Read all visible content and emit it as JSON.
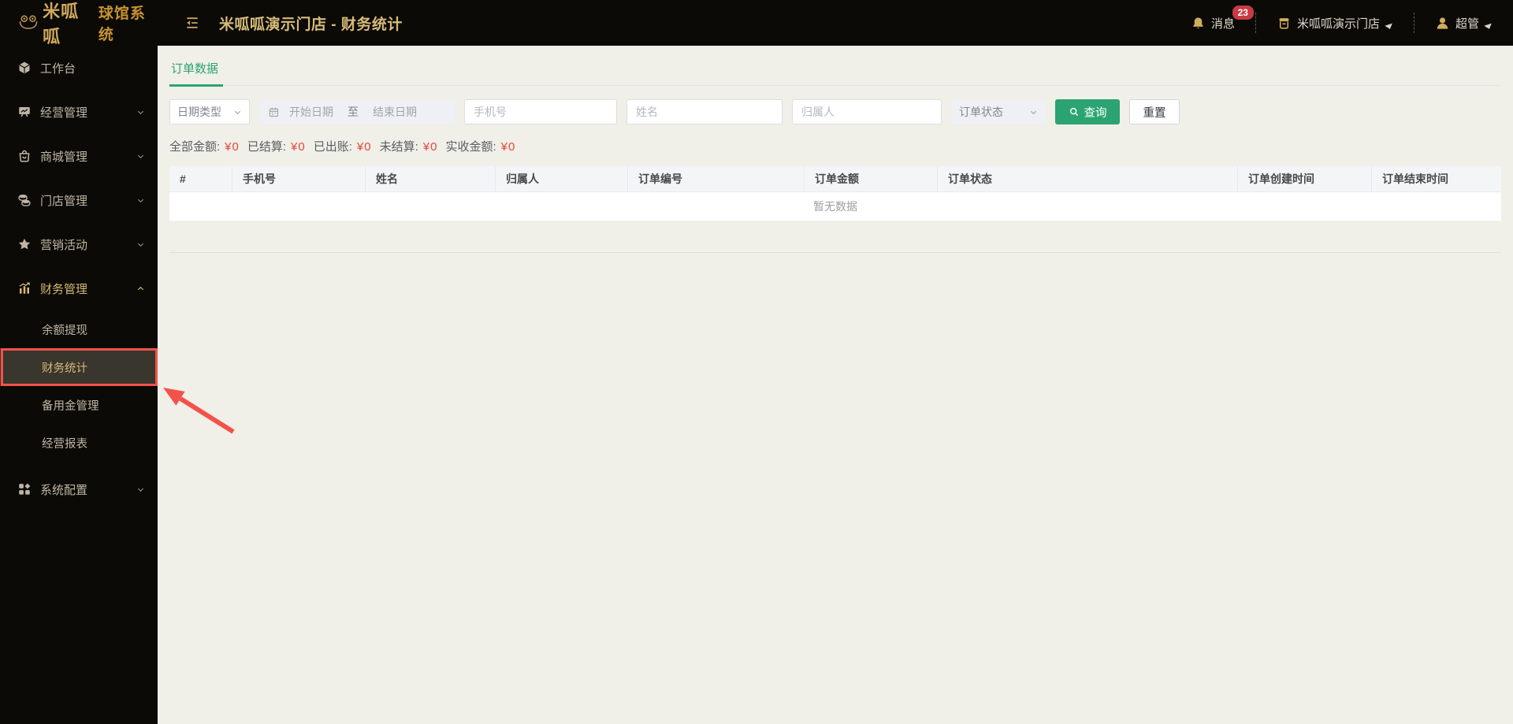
{
  "colors": {
    "accent_green": "#2ba471",
    "value_red": "#e5473c",
    "gold": "#d6b877",
    "annotation_red": "#f3524a",
    "topbar_bg": "#0b0a06",
    "main_bg": "#f0efe8"
  },
  "brand": {
    "logo": "米呱呱",
    "app": "球馆系统"
  },
  "topbar": {
    "title": "米呱呱演示门店 - 财务统计",
    "messages": {
      "label": "消息",
      "badge": "23"
    },
    "store": {
      "label": "米呱呱演示门店"
    },
    "user": {
      "label": "超管"
    }
  },
  "sidebar": {
    "items": [
      {
        "label": "工作台"
      },
      {
        "label": "经营管理"
      },
      {
        "label": "商城管理"
      },
      {
        "label": "门店管理"
      },
      {
        "label": "营销活动"
      },
      {
        "label": "财务管理"
      },
      {
        "label": "系统配置"
      }
    ],
    "finance_submenu": [
      {
        "label": "余额提现"
      },
      {
        "label": "财务统计",
        "active": true
      },
      {
        "label": "备用金管理"
      },
      {
        "label": "经营报表"
      }
    ]
  },
  "main": {
    "tab": "订单数据",
    "filters": {
      "date_type": "日期类型",
      "date_start": "开始日期",
      "date_to": "至",
      "date_end": "结束日期",
      "phone_placeholder": "手机号",
      "name_placeholder": "姓名",
      "owner_placeholder": "归属人",
      "order_status": "订单状态",
      "search_label": "查询",
      "reset_label": "重置"
    },
    "summary": [
      {
        "label": "全部金额:",
        "value": "¥0"
      },
      {
        "label": "已结算:",
        "value": "¥0"
      },
      {
        "label": "已出账:",
        "value": "¥0"
      },
      {
        "label": "未结算:",
        "value": "¥0"
      },
      {
        "label": "实收金额:",
        "value": "¥0"
      }
    ],
    "table": {
      "headers": [
        "#",
        "手机号",
        "姓名",
        "归属人",
        "订单编号",
        "订单金额",
        "订单状态",
        "订单创建时间",
        "订单结束时间"
      ],
      "empty_text": "暂无数据"
    }
  }
}
